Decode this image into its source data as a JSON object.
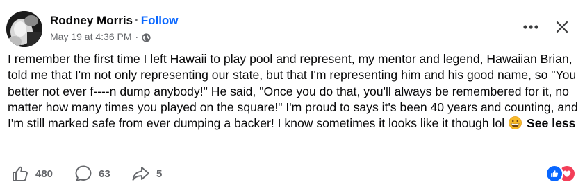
{
  "author": {
    "name": "Rodney Morris",
    "separator": "·",
    "follow_label": "Follow"
  },
  "meta": {
    "timestamp": "May 19 at 4:36 PM",
    "separator": "·",
    "audience_icon": "globe-icon"
  },
  "header_actions": {
    "more_icon": "more-options-icon",
    "close_icon": "close-icon"
  },
  "post": {
    "text": "I remember the first time I left Hawaii to play pool and represent, my mentor and legend, Hawaiian Brian, told me that I'm not only representing our state, but that I'm representing him and his good name, so \"You better not ever f----n dump anybody!\" He said, \"Once you do that, you'll always be remembered for it, no matter how many times you played on the square!\" I'm proud to says it's been 40 years and counting, and I'm still marked safe from ever dumping a backer! I know sometimes it looks like it though lol",
    "emoji": "grinning-face-emoji",
    "see_less_label": "See less"
  },
  "actions": {
    "like_count": "480",
    "comment_count": "63",
    "share_count": "5"
  },
  "reactions": [
    "like-reaction-icon",
    "love-reaction-icon"
  ],
  "colors": {
    "text": "#080809",
    "secondary": "#65676b",
    "link": "#0866ff",
    "like_blue": "#0866ff",
    "love_red": "#f33e58"
  }
}
